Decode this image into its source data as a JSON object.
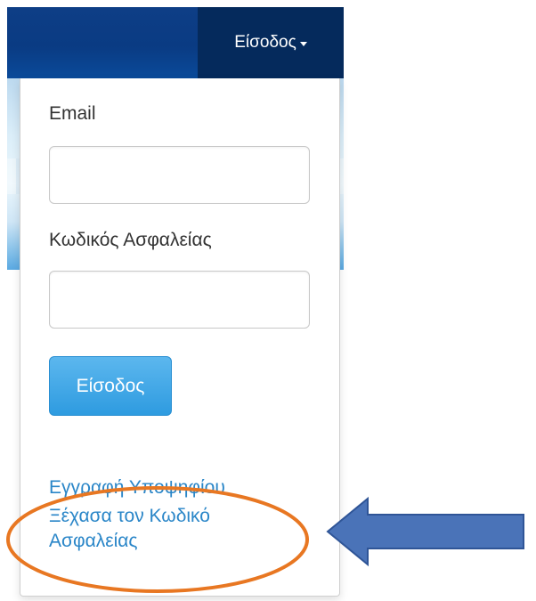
{
  "navbar": {
    "login_label": "Είσοδος"
  },
  "form": {
    "email_label": "Email",
    "email_value": "",
    "password_label": "Κωδικός Ασφαλείας",
    "password_value": "",
    "submit_label": "Είσοδος"
  },
  "links": {
    "register": "Εγγραφή Υποψηφίου",
    "forgot_line1": "Ξέχασα τον Κωδικό",
    "forgot_line2": "Ασφαλείας"
  },
  "colors": {
    "navbar": "#0a3b83",
    "nav_active": "#052a5c",
    "button": "#3aa6e8",
    "link": "#2a86c8",
    "annotation_ellipse": "#e87722",
    "annotation_arrow": "#4a73b8"
  }
}
